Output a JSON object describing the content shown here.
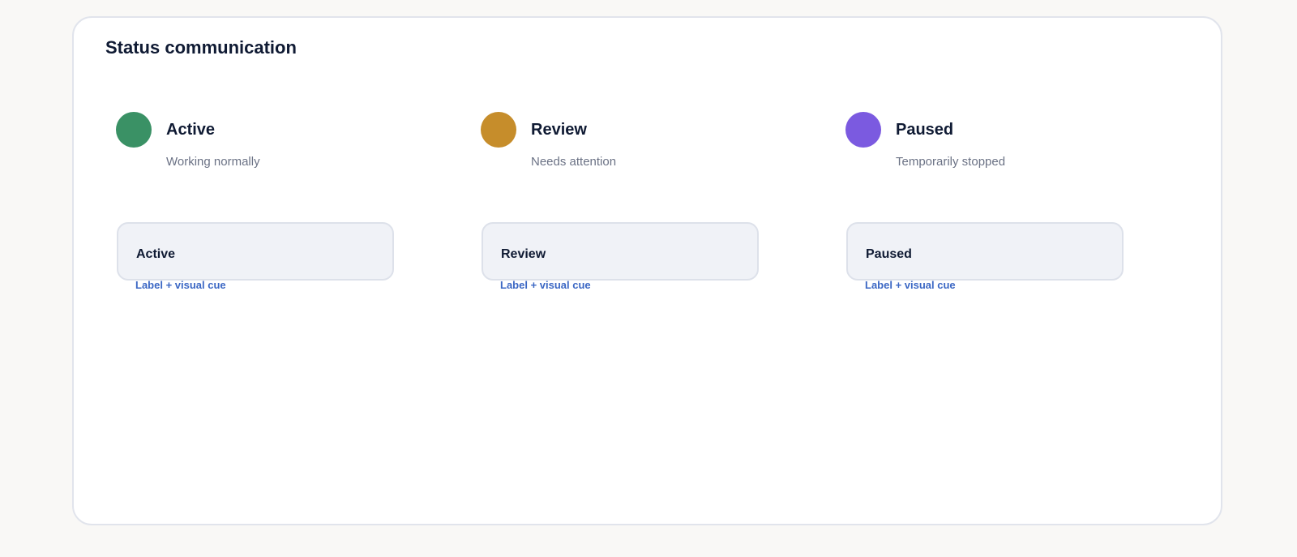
{
  "title": "Status communication",
  "statuses": [
    {
      "label": "Active",
      "description": "Working normally",
      "color": "#3a9165",
      "pill_label": "Active",
      "cue": "Label + visual cue"
    },
    {
      "label": "Review",
      "description": "Needs attention",
      "color": "#c68d2b",
      "pill_label": "Review",
      "cue": "Label + visual cue"
    },
    {
      "label": "Paused",
      "description": "Temporarily stopped",
      "color": "#7b5ae0",
      "pill_label": "Paused",
      "cue": "Label + visual cue"
    }
  ]
}
